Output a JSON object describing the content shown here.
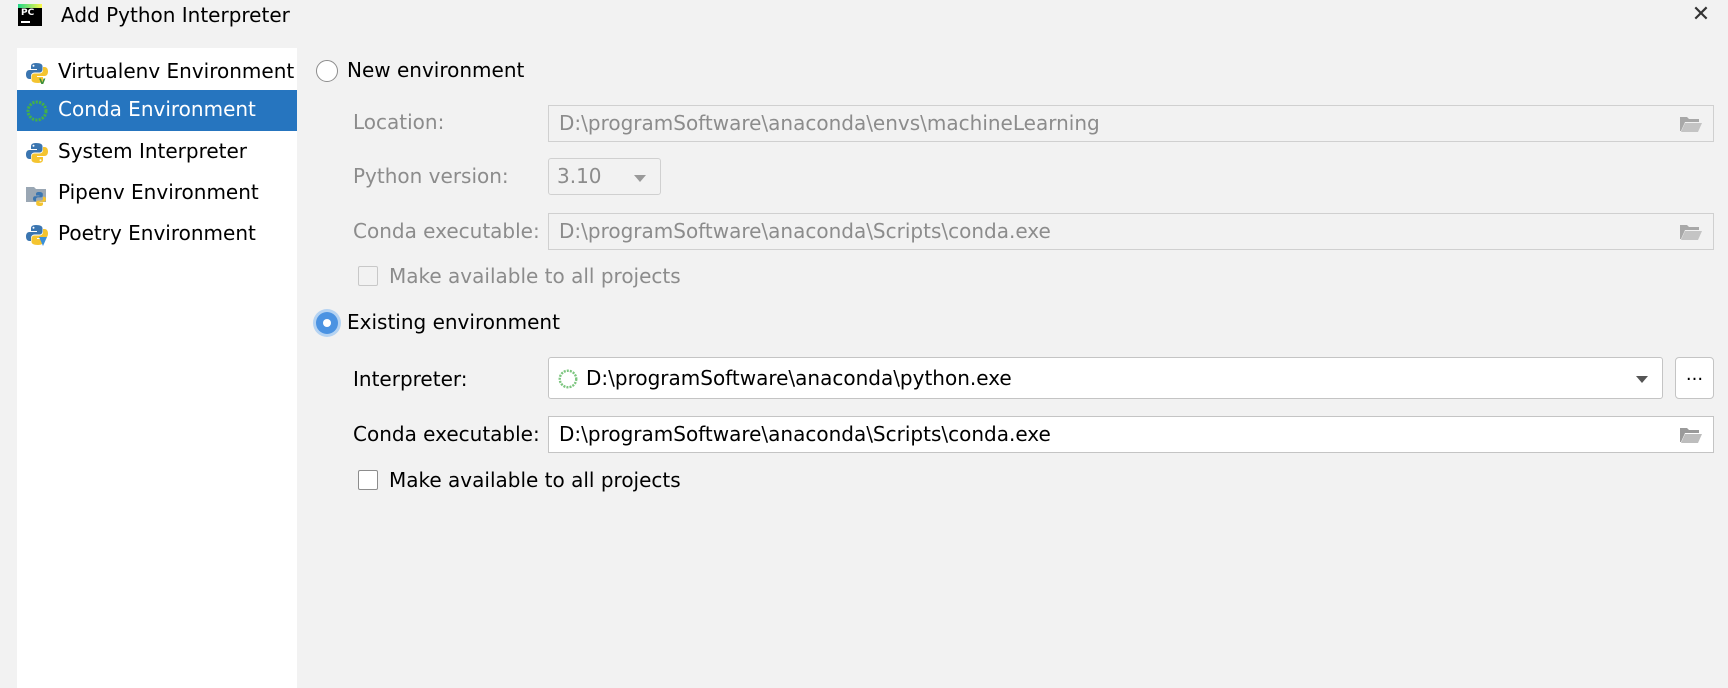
{
  "window": {
    "title": "Add Python Interpreter",
    "logo_text": "PC"
  },
  "sidebar": {
    "items": [
      {
        "label": "Virtualenv Environment",
        "icon": "python-virtualenv-icon"
      },
      {
        "label": "Conda Environment",
        "icon": "conda-icon",
        "selected": true
      },
      {
        "label": "System Interpreter",
        "icon": "python-icon"
      },
      {
        "label": "Pipenv Environment",
        "icon": "pipenv-icon"
      },
      {
        "label": "Poetry Environment",
        "icon": "poetry-icon"
      }
    ]
  },
  "new_env": {
    "label": "New environment",
    "checked": false,
    "location_label": "Location:",
    "location_value": "D:\\programSoftware\\anaconda\\envs\\machineLearning",
    "python_version_label": "Python version:",
    "python_version_value": "3.10",
    "conda_exec_label": "Conda executable:",
    "conda_exec_value": "D:\\programSoftware\\anaconda\\Scripts\\conda.exe",
    "make_available_label": "Make available to all projects",
    "make_available_checked": false
  },
  "existing_env": {
    "label": "Existing environment",
    "checked": true,
    "interpreter_label": "Interpreter:",
    "interpreter_value": "D:\\programSoftware\\anaconda\\python.exe",
    "browse_label": "...",
    "conda_exec_label": "Conda executable:",
    "conda_exec_value": "D:\\programSoftware\\anaconda\\Scripts\\conda.exe",
    "make_available_label": "Make available to all projects",
    "make_available_checked": false
  },
  "colors": {
    "selection": "#2675bf",
    "radio_checked": "#4b93e2",
    "disabled_text": "#8c8c8c"
  }
}
